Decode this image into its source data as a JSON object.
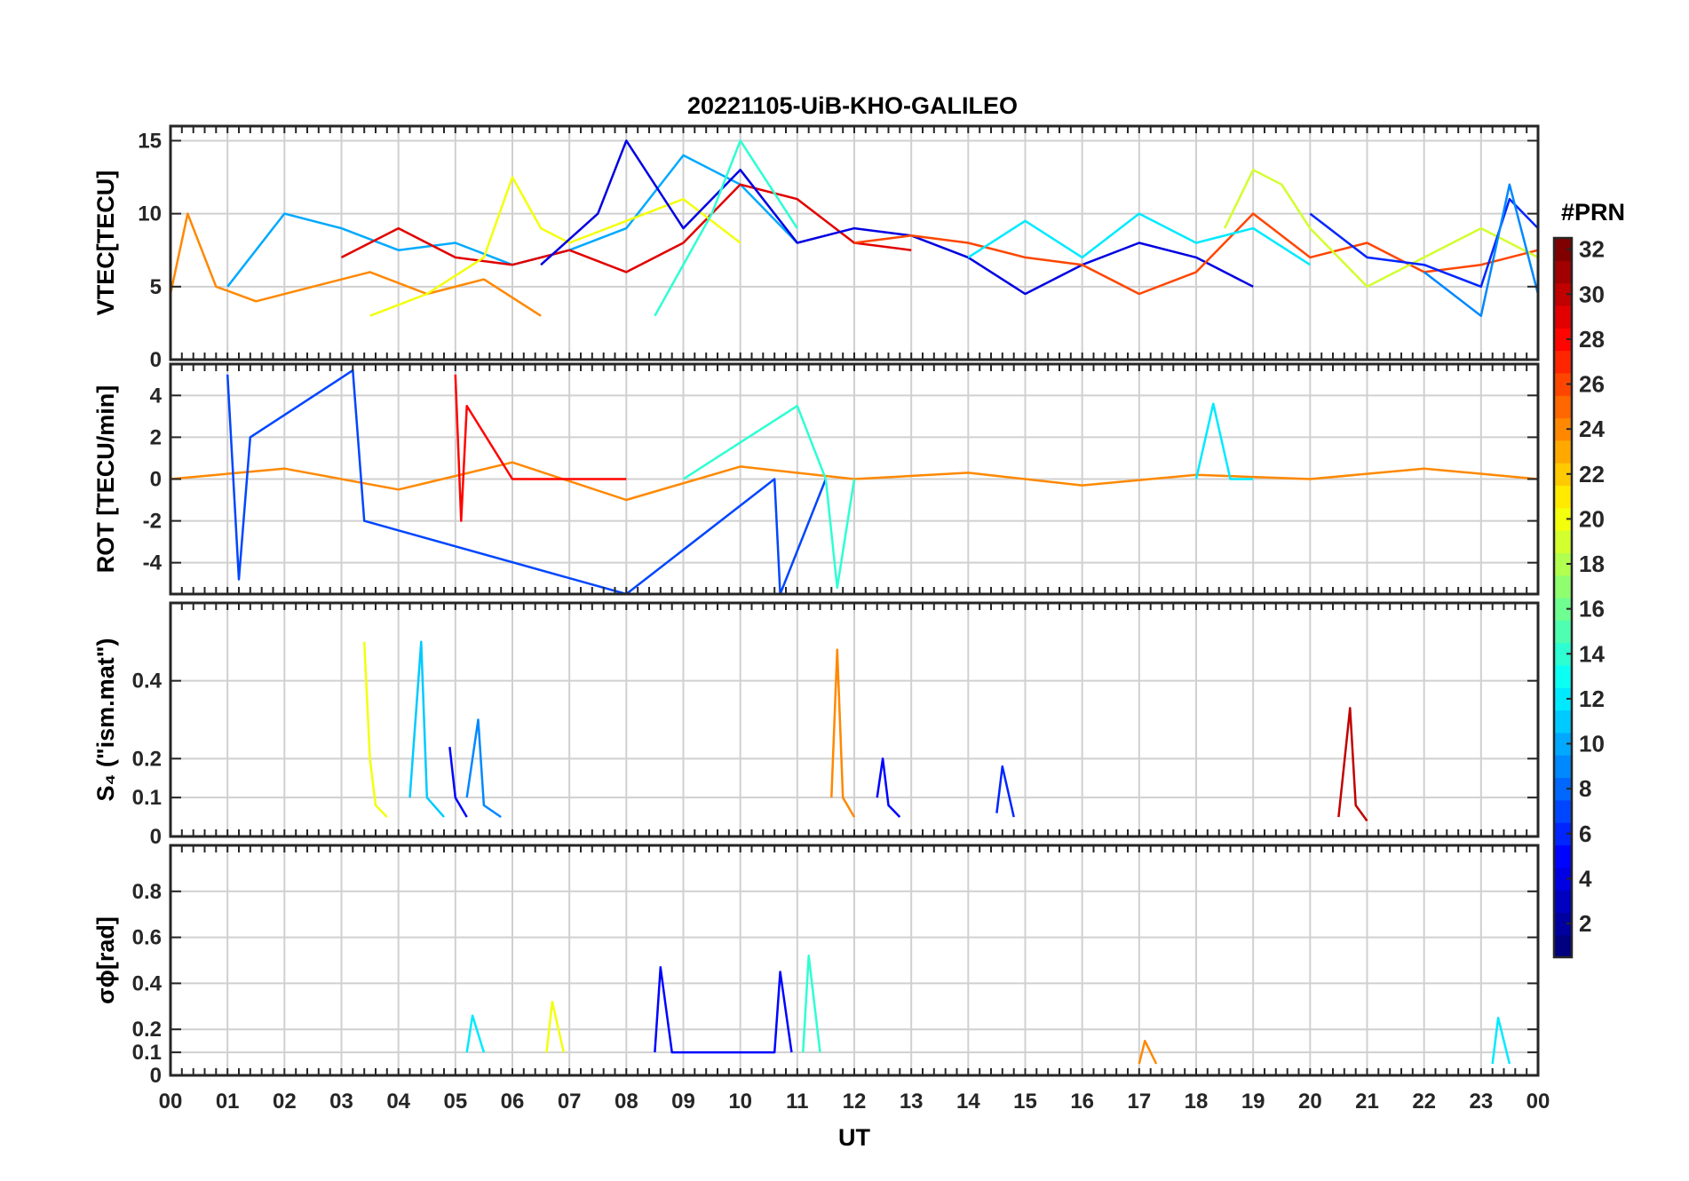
{
  "figure": {
    "title": "20221105-UiB-KHO-GALILEO",
    "xlabel": "UT",
    "colorbar_title": "#PRN"
  },
  "chart_data": [
    {
      "type": "line",
      "panel": "vtec",
      "title": "20221105-UiB-KHO-GALILEO",
      "xlabel": "",
      "ylabel": "VTEC[TECU]",
      "xlim": [
        0,
        24
      ],
      "ylim": [
        0,
        16
      ],
      "yticks": [
        0,
        5,
        10,
        15
      ],
      "ytick_labels": [
        "0",
        "5",
        "10",
        "15"
      ],
      "grid": true,
      "series": [
        {
          "prn": 24,
          "x": [
            0.0,
            0.3,
            0.8,
            1.5,
            2.5,
            3.5,
            4.5,
            5.5,
            6.5
          ],
          "y": [
            4.5,
            10.0,
            5.0,
            4.0,
            5.0,
            6.0,
            4.5,
            5.5,
            3.0
          ]
        },
        {
          "prn": 10,
          "x": [
            1.0,
            2.0,
            3.0,
            4.0,
            5.0,
            6.0,
            7.0,
            8.0,
            9.0,
            10.0,
            11.0
          ],
          "y": [
            5.0,
            10.0,
            9.0,
            7.5,
            8.0,
            6.5,
            7.5,
            9.0,
            14.0,
            12.0,
            8.0
          ]
        },
        {
          "prn": 29,
          "x": [
            3.0,
            4.0,
            5.0,
            6.0,
            7.0,
            8.0,
            9.0,
            10.0,
            11.0,
            12.0,
            13.0
          ],
          "y": [
            7.0,
            9.0,
            7.0,
            6.5,
            7.5,
            6.0,
            8.0,
            12.0,
            11.0,
            8.0,
            7.5
          ]
        },
        {
          "prn": 20,
          "x": [
            3.5,
            4.5,
            5.5,
            6.0,
            6.5,
            7.0,
            8.0,
            9.0,
            10.0
          ],
          "y": [
            3.0,
            4.5,
            7.0,
            12.5,
            9.0,
            8.0,
            9.5,
            11.0,
            8.0
          ]
        },
        {
          "prn": 4,
          "x": [
            6.5,
            7.5,
            8.0,
            9.0,
            10.0,
            11.0,
            12.0,
            13.0,
            14.0,
            15.0,
            16.0,
            17.0,
            18.0,
            19.0
          ],
          "y": [
            6.5,
            10.0,
            15.0,
            9.0,
            13.0,
            8.0,
            9.0,
            8.5,
            7.0,
            4.5,
            6.5,
            8.0,
            7.0,
            5.0
          ]
        },
        {
          "prn": 14,
          "x": [
            8.5,
            9.5,
            10.0,
            10.5,
            11.0
          ],
          "y": [
            3.0,
            10.0,
            15.0,
            12.0,
            9.0
          ]
        },
        {
          "prn": 26,
          "x": [
            12.0,
            13.0,
            14.0,
            15.0,
            16.0,
            17.0,
            18.0,
            19.0,
            20.0,
            21.0,
            22.0,
            23.0,
            24.0
          ],
          "y": [
            8.0,
            8.5,
            8.0,
            7.0,
            6.5,
            4.5,
            6.0,
            10.0,
            7.0,
            8.0,
            6.0,
            6.5,
            7.5
          ]
        },
        {
          "prn": 12,
          "x": [
            14.0,
            15.0,
            16.0,
            17.0,
            18.0,
            19.0,
            20.0
          ],
          "y": [
            7.0,
            9.5,
            7.0,
            10.0,
            8.0,
            9.0,
            6.5
          ]
        },
        {
          "prn": 19,
          "x": [
            18.5,
            19.0,
            19.5,
            20.0,
            21.0,
            22.0,
            23.0,
            24.0
          ],
          "y": [
            9.0,
            13.0,
            12.0,
            9.0,
            5.0,
            7.0,
            9.0,
            7.0
          ]
        },
        {
          "prn": 6,
          "x": [
            20.0,
            21.0,
            22.0,
            23.0,
            23.5,
            24.0
          ],
          "y": [
            10.0,
            7.0,
            6.5,
            5.0,
            11.0,
            9.0
          ]
        },
        {
          "prn": 9,
          "x": [
            22.0,
            23.0,
            23.5,
            24.0
          ],
          "y": [
            6.0,
            3.0,
            12.0,
            4.5
          ]
        }
      ]
    },
    {
      "type": "line",
      "panel": "rot",
      "xlabel": "",
      "ylabel": "ROT [TECU/min]",
      "xlim": [
        0,
        24
      ],
      "ylim": [
        -5.5,
        5.5
      ],
      "yticks": [
        -4,
        -2,
        0,
        2,
        4
      ],
      "ytick_labels": [
        "-4",
        "-2",
        "0",
        "2",
        "4"
      ],
      "grid": true,
      "series": [
        {
          "prn": 24,
          "x": [
            0.0,
            2.0,
            4.0,
            6.0,
            8.0,
            10.0,
            12.0,
            14.0,
            16.0,
            18.0,
            20.0,
            22.0,
            24.0
          ],
          "y": [
            0.0,
            0.5,
            -0.5,
            0.8,
            -1.0,
            0.6,
            0.0,
            0.3,
            -0.3,
            0.2,
            0.0,
            0.5,
            0.0
          ]
        },
        {
          "prn": 7,
          "x": [
            1.0,
            1.2,
            1.4,
            3.2,
            3.4,
            8.0,
            10.6,
            10.7,
            11.5
          ],
          "y": [
            5.0,
            -4.8,
            2.0,
            5.2,
            -2.0,
            -5.5,
            0.0,
            -5.5,
            0.0
          ]
        },
        {
          "prn": 28,
          "x": [
            5.0,
            5.1,
            5.2,
            6.0,
            8.0
          ],
          "y": [
            5.0,
            -2.0,
            3.5,
            0.0,
            0.0
          ]
        },
        {
          "prn": 14,
          "x": [
            9.0,
            11.0,
            11.5,
            11.7,
            12.0
          ],
          "y": [
            0.0,
            3.5,
            0.0,
            -5.2,
            0.0
          ]
        },
        {
          "prn": 12,
          "x": [
            18.0,
            18.3,
            18.6,
            19.0
          ],
          "y": [
            0.0,
            3.6,
            0.0,
            0.0
          ]
        }
      ]
    },
    {
      "type": "line",
      "panel": "s4",
      "xlabel": "",
      "ylabel": "S₄ (\"ism.mat\")",
      "xlim": [
        0,
        24
      ],
      "ylim": [
        0,
        0.6
      ],
      "yticks": [
        0,
        0.1,
        0.2,
        0.4
      ],
      "ytick_labels": [
        "0",
        "0.1",
        "0.2",
        "0.4"
      ],
      "grid": true,
      "series": [
        {
          "prn": 20,
          "x": [
            3.4,
            3.5,
            3.6,
            3.8
          ],
          "y": [
            0.5,
            0.2,
            0.08,
            0.05
          ]
        },
        {
          "prn": 11,
          "x": [
            4.2,
            4.4,
            4.5,
            4.8
          ],
          "y": [
            0.1,
            0.5,
            0.1,
            0.05
          ]
        },
        {
          "prn": 9,
          "x": [
            5.2,
            5.4,
            5.5,
            5.8
          ],
          "y": [
            0.1,
            0.3,
            0.08,
            0.05
          ]
        },
        {
          "prn": 5,
          "x": [
            4.9,
            5.0,
            5.2
          ],
          "y": [
            0.23,
            0.1,
            0.05
          ]
        },
        {
          "prn": 24,
          "x": [
            11.6,
            11.7,
            11.8,
            12.0
          ],
          "y": [
            0.1,
            0.48,
            0.1,
            0.05
          ]
        },
        {
          "prn": 5,
          "x": [
            12.4,
            12.5,
            12.6,
            12.8
          ],
          "y": [
            0.1,
            0.2,
            0.08,
            0.05
          ]
        },
        {
          "prn": 30,
          "x": [
            20.5,
            20.7,
            20.8,
            21.0
          ],
          "y": [
            0.05,
            0.33,
            0.08,
            0.04
          ]
        },
        {
          "prn": 6,
          "x": [
            14.5,
            14.6,
            14.8
          ],
          "y": [
            0.06,
            0.18,
            0.05
          ]
        }
      ]
    },
    {
      "type": "line",
      "panel": "sigma_phi",
      "xlabel": "UT",
      "ylabel": "σϕ[rad]",
      "xlim": [
        0,
        24
      ],
      "ylim": [
        0,
        1
      ],
      "yticks": [
        0,
        0.1,
        0.2,
        0.4,
        0.6,
        0.8
      ],
      "ytick_labels": [
        "0",
        "0.1",
        "0.2",
        "0.4",
        "0.6",
        "0.8"
      ],
      "xticks": [
        0,
        1,
        2,
        3,
        4,
        5,
        6,
        7,
        8,
        9,
        10,
        11,
        12,
        13,
        14,
        15,
        16,
        17,
        18,
        19,
        20,
        21,
        22,
        23,
        24
      ],
      "xtick_labels": [
        "00",
        "01",
        "02",
        "03",
        "04",
        "05",
        "06",
        "07",
        "08",
        "09",
        "10",
        "11",
        "12",
        "13",
        "14",
        "15",
        "16",
        "17",
        "18",
        "19",
        "20",
        "21",
        "22",
        "23",
        "00"
      ],
      "grid": true,
      "series": [
        {
          "prn": 5,
          "x": [
            8.5,
            8.6,
            8.8,
            10.6,
            10.7,
            10.9
          ],
          "y": [
            0.1,
            0.47,
            0.1,
            0.1,
            0.45,
            0.1
          ]
        },
        {
          "prn": 14,
          "x": [
            11.1,
            11.2,
            11.4
          ],
          "y": [
            0.1,
            0.52,
            0.1
          ]
        },
        {
          "prn": 20,
          "x": [
            6.6,
            6.7,
            6.9
          ],
          "y": [
            0.1,
            0.32,
            0.1
          ]
        },
        {
          "prn": 12,
          "x": [
            5.2,
            5.3,
            5.5
          ],
          "y": [
            0.1,
            0.26,
            0.1
          ]
        },
        {
          "prn": 24,
          "x": [
            17.0,
            17.1,
            17.3
          ],
          "y": [
            0.05,
            0.15,
            0.05
          ]
        },
        {
          "prn": 12,
          "x": [
            23.2,
            23.3,
            23.5
          ],
          "y": [
            0.05,
            0.25,
            0.05
          ]
        }
      ]
    }
  ],
  "colorbar": {
    "min": 1,
    "max": 32,
    "ticks": [
      2,
      4,
      6,
      8,
      10,
      12,
      14,
      16,
      18,
      20,
      22,
      24,
      26,
      28,
      30,
      32
    ],
    "tick_labels": [
      "2",
      "4",
      "6",
      "8",
      "10",
      "12",
      "14",
      "16",
      "18",
      "20",
      "22",
      "24",
      "26",
      "28",
      "30",
      "32"
    ],
    "colormap": "jet"
  }
}
